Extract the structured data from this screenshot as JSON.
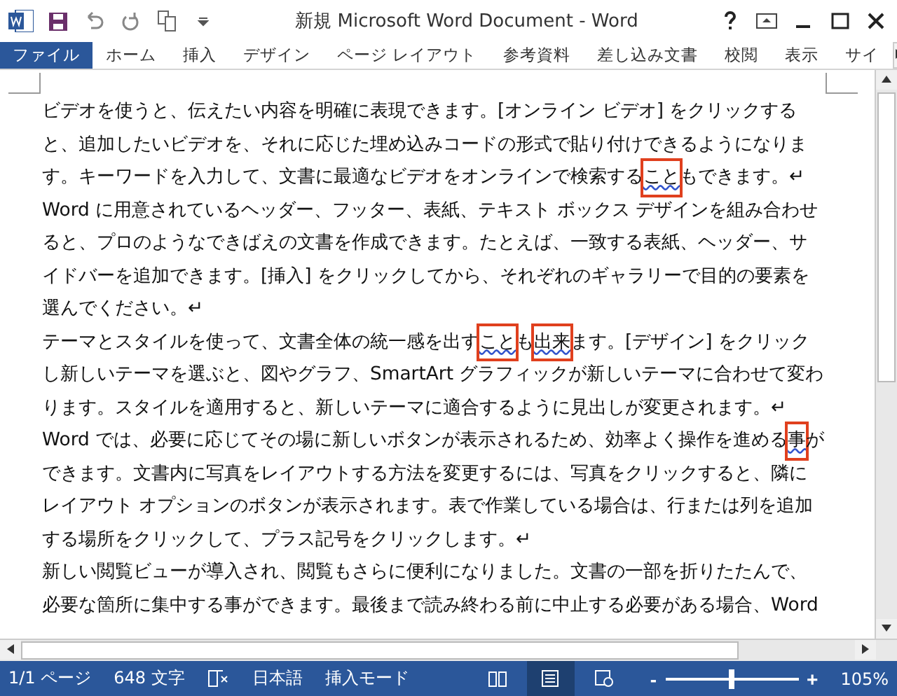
{
  "window": {
    "title": "新規 Microsoft Word Document - Word"
  },
  "ribbon_tabs": [
    {
      "label": "ファイル",
      "selected": true
    },
    {
      "label": "ホーム",
      "selected": false
    },
    {
      "label": "挿入",
      "selected": false
    },
    {
      "label": "デザイン",
      "selected": false
    },
    {
      "label": "ページ レイアウト",
      "selected": false
    },
    {
      "label": "参考資料",
      "selected": false
    },
    {
      "label": "差し込み文書",
      "selected": false
    },
    {
      "label": "校閲",
      "selected": false
    },
    {
      "label": "表示",
      "selected": false
    },
    {
      "label": "サイ",
      "selected": false
    }
  ],
  "document": {
    "paragraphs": [
      {
        "lines": [
          [
            {
              "text": "ビデオを使うと、伝えたい内容を明確に表現できます。[オンライン ビデオ] をクリックする",
              "flagged": false
            }
          ],
          [
            {
              "text": "と、追加したいビデオを、それに応じた埋め込みコードの形式で貼り付けできるようになりま",
              "flagged": false
            }
          ],
          [
            {
              "text": "す。キーワードを入力して、文書に最適なビデオをオンラインで検索する",
              "flagged": false
            },
            {
              "text": "こと",
              "flagged": true
            },
            {
              "text": "もできます。↵",
              "flagged": false
            }
          ]
        ]
      },
      {
        "lines": [
          [
            {
              "text": "Word に用意されているヘッダー、フッター、表紙、テキスト ボックス デザインを組み合わせ",
              "flagged": false
            }
          ],
          [
            {
              "text": "ると、プロのようなできばえの文書を作成できます。たとえば、一致する表紙、ヘッダー、サ",
              "flagged": false
            }
          ],
          [
            {
              "text": "イドバーを追加できます。[挿入] をクリックしてから、それぞれのギャラリーで目的の要素を",
              "flagged": false
            }
          ],
          [
            {
              "text": "選んでください。↵",
              "flagged": false
            }
          ]
        ]
      },
      {
        "lines": [
          [
            {
              "text": "テーマとスタイルを使って、文書全体の統一感を出す",
              "flagged": false
            },
            {
              "text": "こと",
              "flagged": true
            },
            {
              "text": "も",
              "flagged": false
            },
            {
              "text": "出来",
              "flagged": true
            },
            {
              "text": "ます。[デザイン] をクリック",
              "flagged": false
            }
          ],
          [
            {
              "text": "し新しいテーマを選ぶと、図やグラフ、SmartArt グラフィックが新しいテーマに合わせて変わ",
              "flagged": false
            }
          ],
          [
            {
              "text": "ります。スタイルを適用すると、新しいテーマに適合するように見出しが変更されます。↵",
              "flagged": false
            }
          ]
        ]
      },
      {
        "lines": [
          [
            {
              "text": "Word では、必要に応じてその場に新しいボタンが表示されるため、効率よく操作を進める",
              "flagged": false
            },
            {
              "text": "事",
              "flagged": true
            },
            {
              "text": "が",
              "flagged": false
            }
          ],
          [
            {
              "text": "できます。文書内に写真をレイアウトする方法を変更するには、写真をクリックすると、隣に",
              "flagged": false
            }
          ],
          [
            {
              "text": "レイアウト オプションのボタンが表示されます。表で作業している場合は、行または列を追加",
              "flagged": false
            }
          ],
          [
            {
              "text": "する場所をクリックして、プラス記号をクリックします。↵",
              "flagged": false
            }
          ]
        ]
      },
      {
        "lines": [
          [
            {
              "text": "新しい閲覧ビューが導入され、閲覧もさらに便利になりました。文書の一部を折りたたんで、",
              "flagged": false
            }
          ],
          [
            {
              "text": "必要な箇所に集中する事ができます。最後まで読み終わる前に中止する必要がある場合、Word",
              "flagged": false
            }
          ]
        ]
      }
    ]
  },
  "status_bar": {
    "page": "1/1 ページ",
    "words": "648 文字",
    "language": "日本語",
    "mode": "挿入モード",
    "views": [
      {
        "kind": "read",
        "selected": false
      },
      {
        "kind": "print",
        "selected": true
      },
      {
        "kind": "web",
        "selected": false
      }
    ],
    "zoom": {
      "minus": "-",
      "plus": "+",
      "level": 0.5,
      "reading": "105%"
    }
  }
}
